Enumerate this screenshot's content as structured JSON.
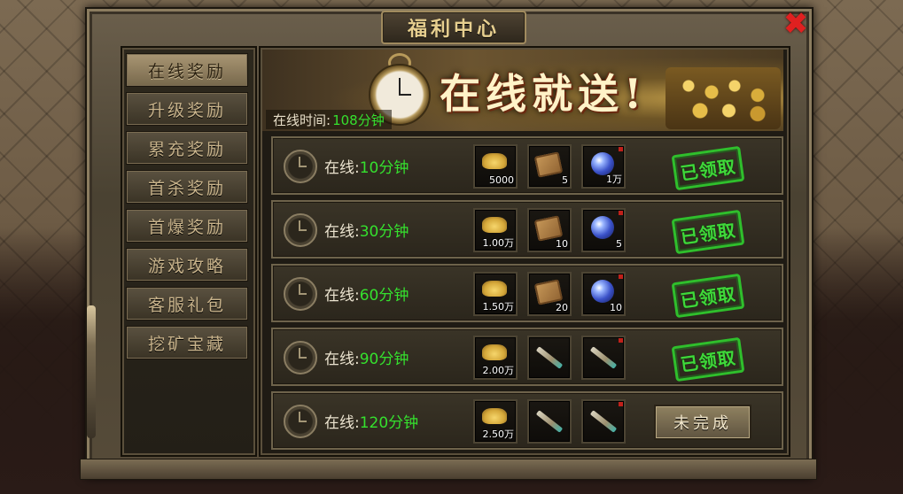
{
  "window": {
    "title": "福利中心"
  },
  "sidebar": {
    "items": [
      {
        "label": "在线奖励",
        "active": true
      },
      {
        "label": "升级奖励",
        "active": false
      },
      {
        "label": "累充奖励",
        "active": false
      },
      {
        "label": "首杀奖励",
        "active": false
      },
      {
        "label": "首爆奖励",
        "active": false
      },
      {
        "label": "游戏攻略",
        "active": false
      },
      {
        "label": "客服礼包",
        "active": false
      },
      {
        "label": "挖矿宝藏",
        "active": false
      }
    ]
  },
  "banner": {
    "slogan": "在线就送!"
  },
  "status": {
    "online_time_label": "在线时间:",
    "online_time_value": "108分钟"
  },
  "rewards": [
    {
      "prefix": "在线:",
      "duration": "10分钟",
      "items": [
        {
          "icon": "gold-ingot-icon",
          "qty": "5000"
        },
        {
          "icon": "scroll-icon",
          "qty": "5"
        },
        {
          "icon": "orb-icon",
          "qty": "1万"
        }
      ],
      "status": "已领取",
      "claimed": true
    },
    {
      "prefix": "在线:",
      "duration": "30分钟",
      "items": [
        {
          "icon": "gold-ingot-icon",
          "qty": "1.00万"
        },
        {
          "icon": "scroll-icon",
          "qty": "10"
        },
        {
          "icon": "orb-icon",
          "qty": "5"
        }
      ],
      "status": "已领取",
      "claimed": true
    },
    {
      "prefix": "在线:",
      "duration": "60分钟",
      "items": [
        {
          "icon": "gold-ingot-icon",
          "qty": "1.50万"
        },
        {
          "icon": "scroll-icon",
          "qty": "20"
        },
        {
          "icon": "orb-icon",
          "qty": "10"
        }
      ],
      "status": "已领取",
      "claimed": true
    },
    {
      "prefix": "在线:",
      "duration": "90分钟",
      "items": [
        {
          "icon": "gold-ingot-icon",
          "qty": "2.00万"
        },
        {
          "icon": "feather-stick-icon",
          "qty": ""
        },
        {
          "icon": "feather-stick-icon",
          "qty": ""
        }
      ],
      "status": "已领取",
      "claimed": true
    },
    {
      "prefix": "在线:",
      "duration": "120分钟",
      "items": [
        {
          "icon": "gold-ingot-icon",
          "qty": "2.50万"
        },
        {
          "icon": "feather-stick-icon",
          "qty": ""
        },
        {
          "icon": "feather-stick-icon",
          "qty": ""
        }
      ],
      "status": "未完成",
      "claimed": false
    }
  ],
  "colors": {
    "accent_green": "#35e02e",
    "gold_text": "#e7cf8f",
    "close_red": "#e02020"
  }
}
